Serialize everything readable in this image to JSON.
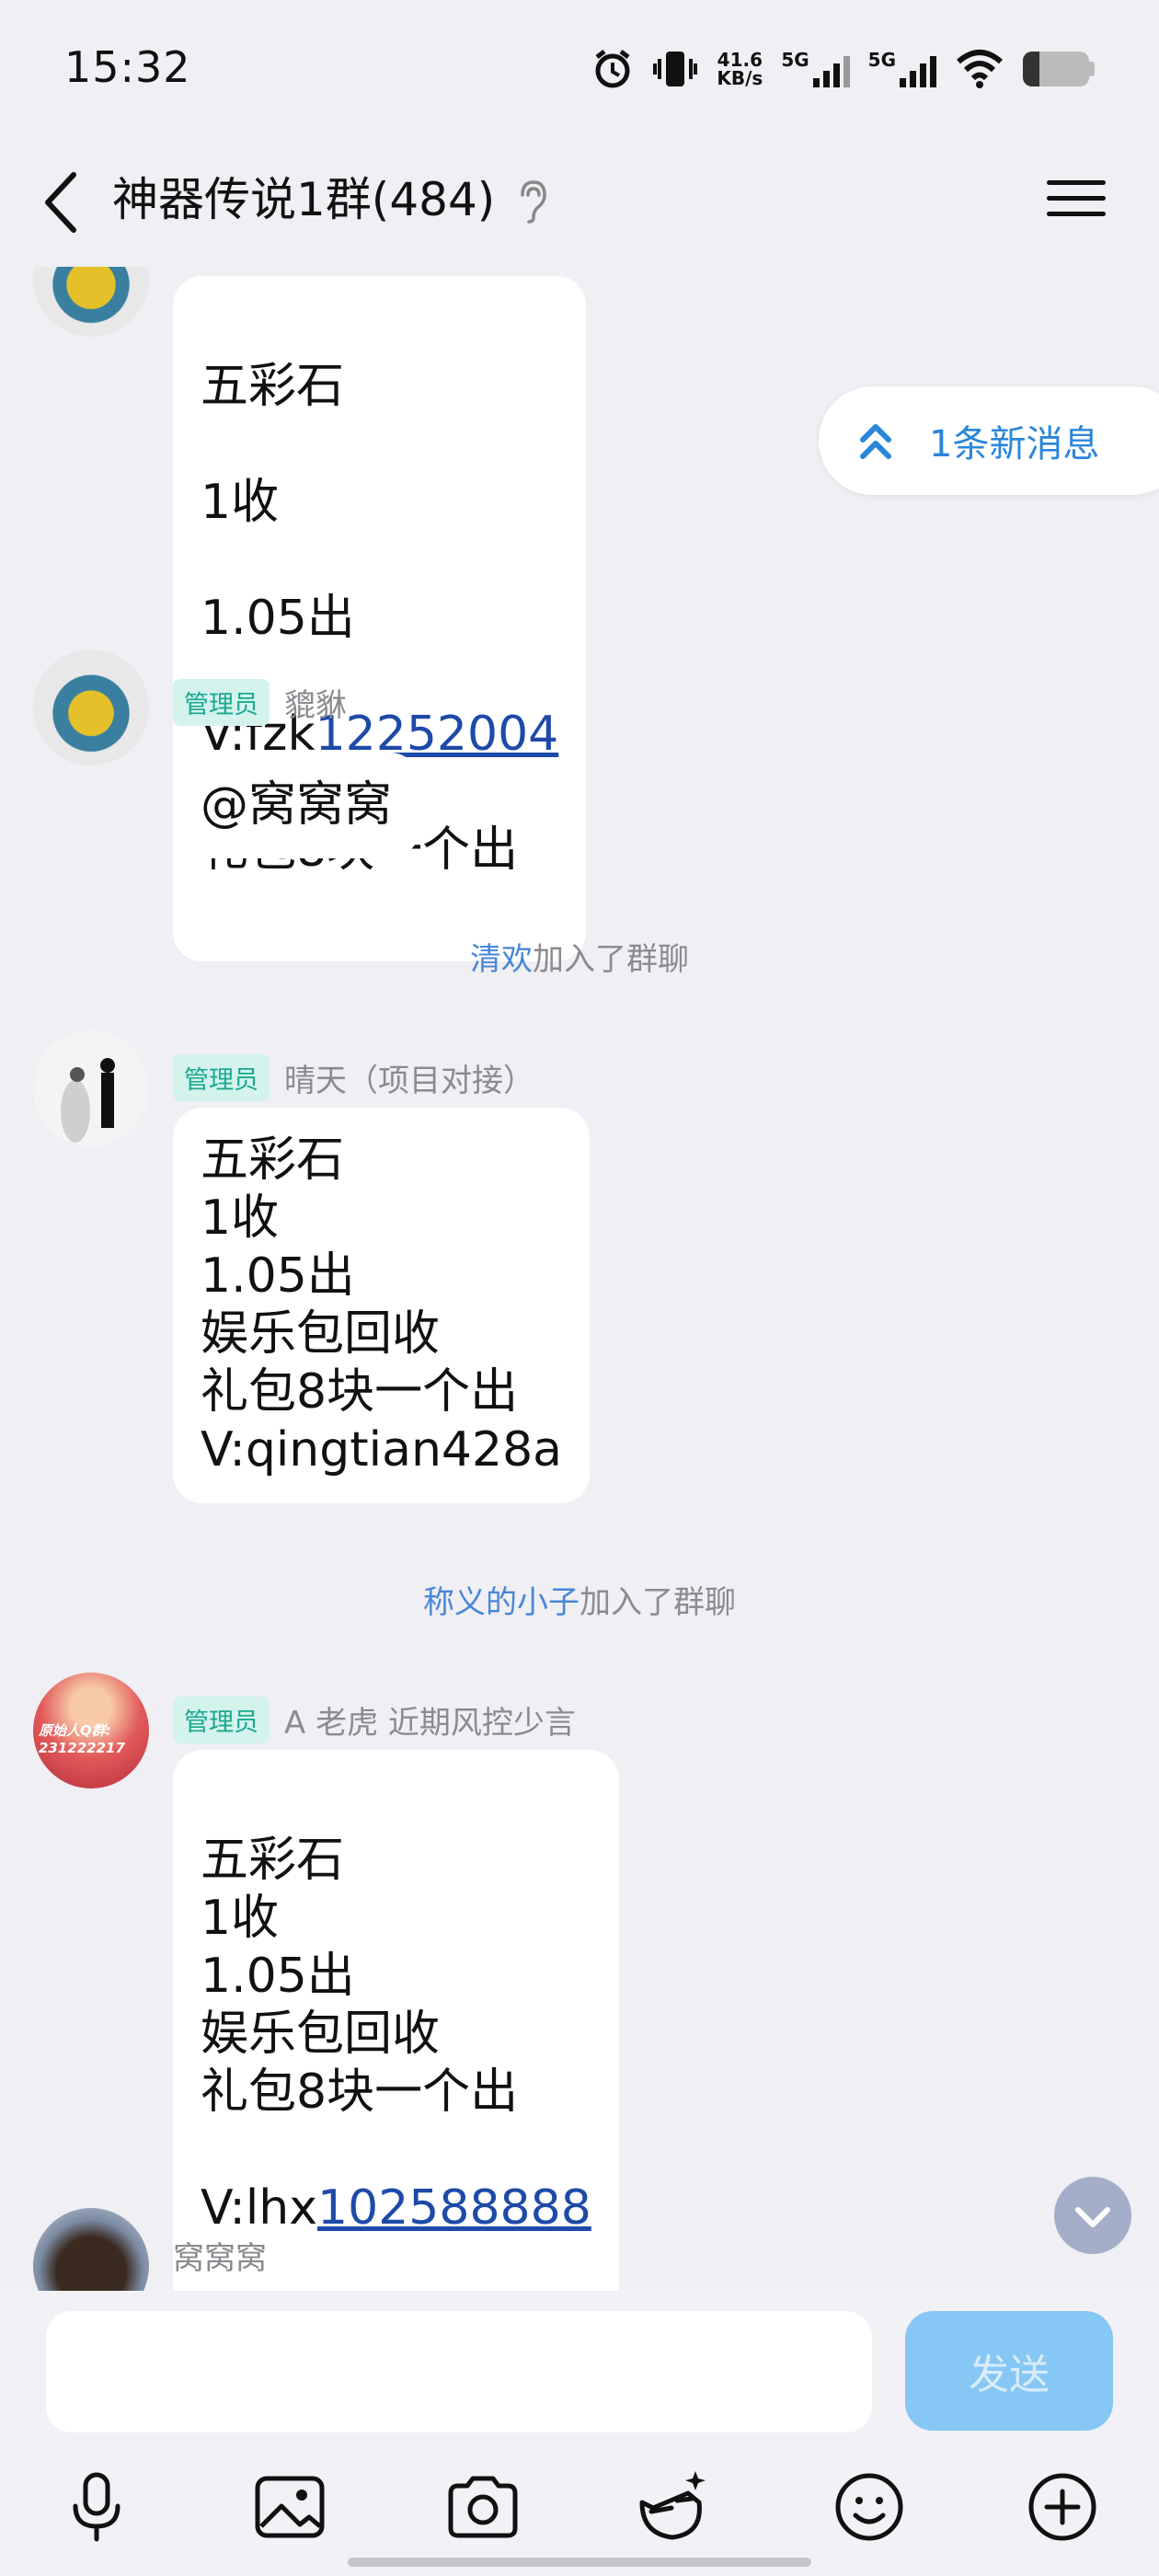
{
  "status": {
    "time": "15:32",
    "net_speed_value": "41.6",
    "net_speed_unit": "KB/s",
    "sim1": "5G",
    "sim2": "5G",
    "battery_level": 0.25
  },
  "header": {
    "title": "神器传说1群(484)"
  },
  "new_messages_pill": "1条新消息",
  "messages": [
    {
      "lines": [
        "五彩石",
        "1收",
        "1.05出"
      ],
      "v_prefix": "V:fzk",
      "v_link": "12252004",
      "tail": "礼包8块一个出"
    },
    {
      "badge": "管理员",
      "sender": "貔貅",
      "text": "@窝窝窝"
    },
    {
      "system_name": "清欢",
      "system_action": "加入了群聊"
    },
    {
      "badge": "管理员",
      "sender": "晴天（项目对接）",
      "text": "五彩石\n1收\n1.05出\n娱乐包回收\n礼包8块一个出\nV:qingtian428a"
    },
    {
      "system_name": "称义的小子",
      "system_action": "加入了群聊"
    },
    {
      "badge": "管理员",
      "sender": "A 老虎 近期风控少言",
      "text": "五彩石\n1收\n1.05出\n娱乐包回收\n礼包8块一个出",
      "v_prefix": "V:lhx",
      "v_link": "102588888",
      "avatar_text": "原始人Q群:\n231222217"
    },
    {
      "sender": "窝窝窝"
    }
  ],
  "input": {
    "placeholder": "",
    "send_label": "发送"
  },
  "toolbar": {
    "items": [
      "mic-icon",
      "image-icon",
      "camera-icon",
      "sticker-icon",
      "emoji-icon",
      "plus-icon"
    ]
  },
  "colors": {
    "background": "#efeff4",
    "admin_badge_bg": "#d3f3ec",
    "admin_badge_text": "#1aa88f",
    "link": "#1e4aa8",
    "system_name": "#4a86d8",
    "send_button": "#87c7f5"
  }
}
